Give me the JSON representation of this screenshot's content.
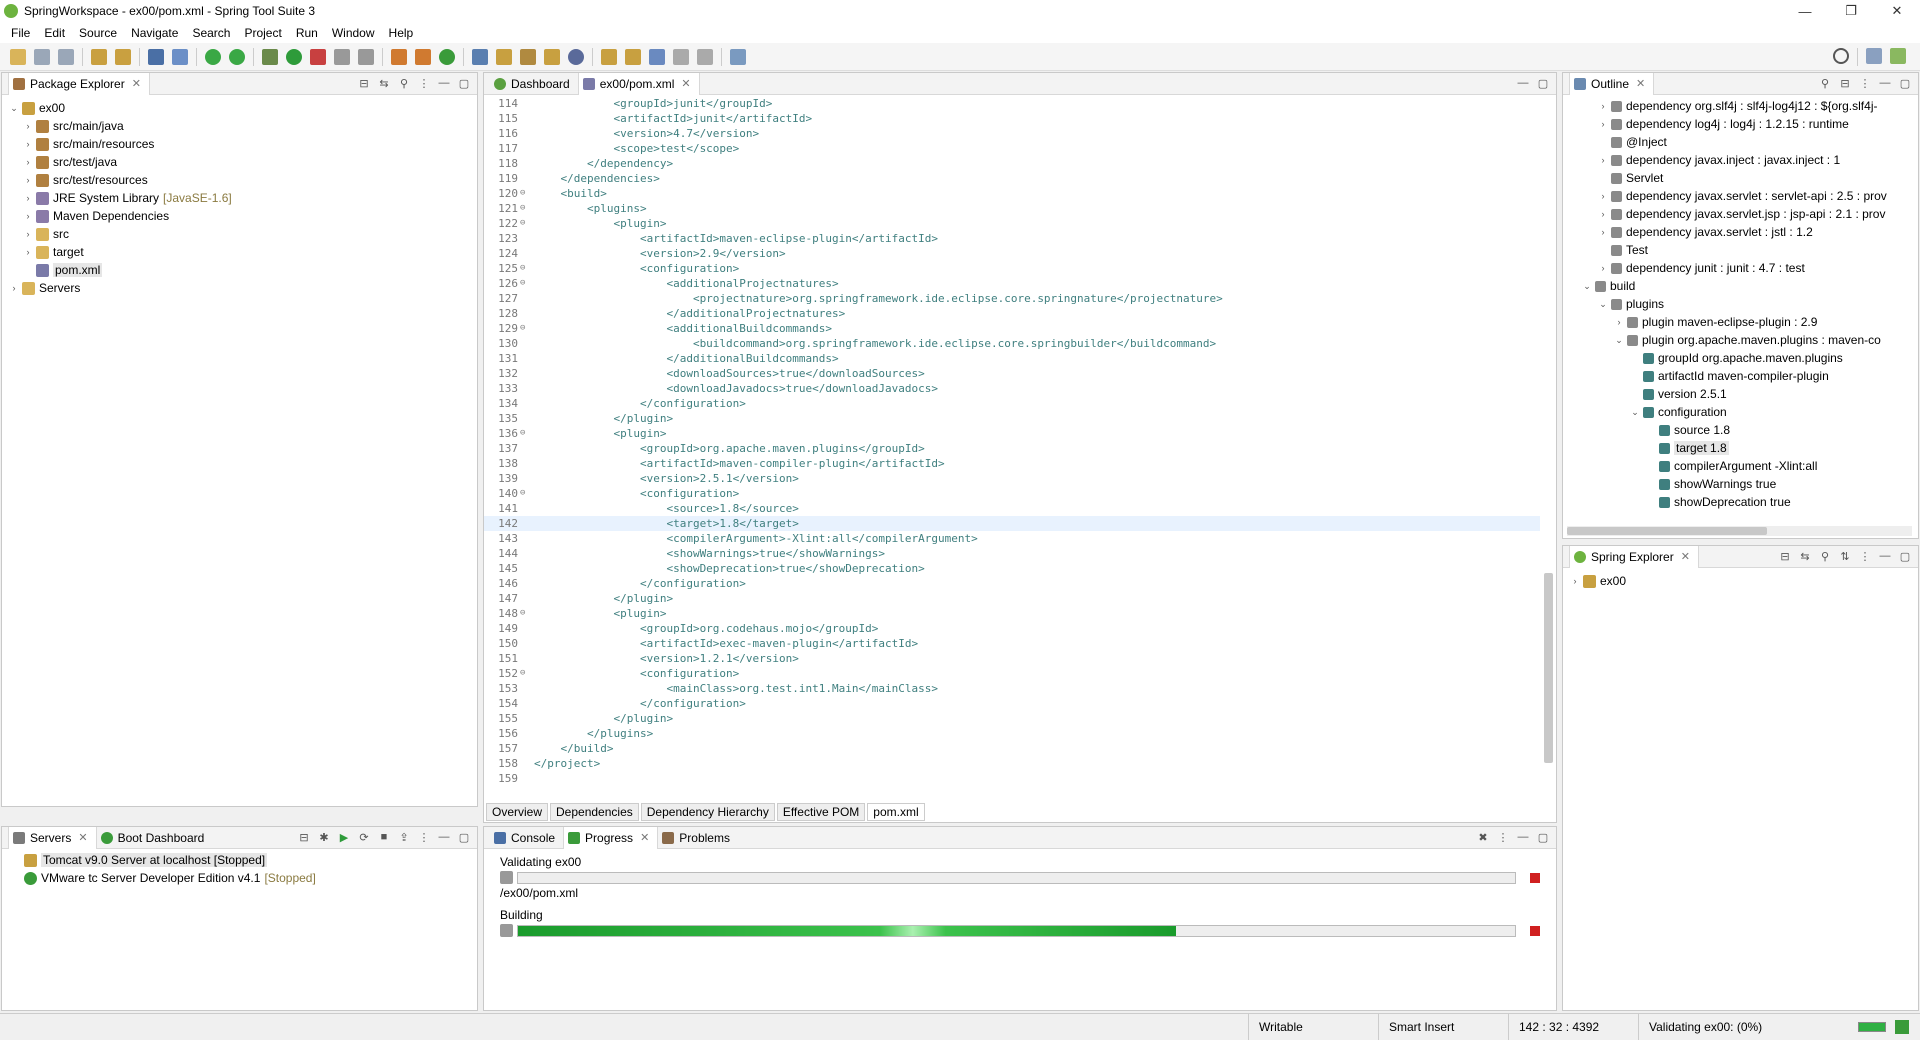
{
  "window": {
    "title": "SpringWorkspace - ex00/pom.xml - Spring Tool Suite 3",
    "controls": [
      "—",
      "❐",
      "✕"
    ]
  },
  "menu": [
    "File",
    "Edit",
    "Source",
    "Navigate",
    "Search",
    "Project",
    "Run",
    "Window",
    "Help"
  ],
  "package_explorer": {
    "tab_label": "Package Explorer",
    "items": [
      {
        "label": "ex00",
        "expanded": true,
        "depth": 0,
        "icon": "project-icon"
      },
      {
        "label": "src/main/java",
        "depth": 1,
        "icon": "source-folder-icon"
      },
      {
        "label": "src/main/resources",
        "depth": 1,
        "icon": "source-folder-icon"
      },
      {
        "label": "src/test/java",
        "depth": 1,
        "icon": "source-folder-icon"
      },
      {
        "label": "src/test/resources",
        "depth": 1,
        "icon": "source-folder-icon"
      },
      {
        "label": "JRE System Library",
        "extra": "[JavaSE-1.6]",
        "depth": 1,
        "icon": "library-icon"
      },
      {
        "label": "Maven Dependencies",
        "depth": 1,
        "icon": "library-icon"
      },
      {
        "label": "src",
        "depth": 1,
        "icon": "folder-icon"
      },
      {
        "label": "target",
        "depth": 1,
        "icon": "folder-icon"
      },
      {
        "label": "pom.xml",
        "depth": 1,
        "icon": "xml-file-icon",
        "selected": true
      },
      {
        "label": "Servers",
        "depth": 0,
        "icon": "folder-icon"
      }
    ]
  },
  "editor": {
    "tabs": [
      {
        "label": "Dashboard",
        "active": false
      },
      {
        "label": "ex00/pom.xml",
        "active": true
      }
    ],
    "lines": [
      {
        "n": "114",
        "text": "            <groupId>junit</groupId>"
      },
      {
        "n": "115",
        "text": "            <artifactId>junit</artifactId>"
      },
      {
        "n": "116",
        "text": "            <version>4.7</version>"
      },
      {
        "n": "117",
        "text": "            <scope>test</scope>"
      },
      {
        "n": "118",
        "text": "        </dependency>"
      },
      {
        "n": "119",
        "text": "    </dependencies>"
      },
      {
        "n": "120",
        "text": "    <build>",
        "fold": true
      },
      {
        "n": "121",
        "text": "        <plugins>",
        "fold": true
      },
      {
        "n": "122",
        "text": "            <plugin>",
        "fold": true
      },
      {
        "n": "123",
        "text": "                <artifactId>maven-eclipse-plugin</artifactId>"
      },
      {
        "n": "124",
        "text": "                <version>2.9</version>"
      },
      {
        "n": "125",
        "text": "                <configuration>",
        "fold": true
      },
      {
        "n": "126",
        "text": "                    <additionalProjectnatures>",
        "fold": true
      },
      {
        "n": "127",
        "text": "                        <projectnature>org.springframework.ide.eclipse.core.springnature</projectnature>"
      },
      {
        "n": "128",
        "text": "                    </additionalProjectnatures>"
      },
      {
        "n": "129",
        "text": "                    <additionalBuildcommands>",
        "fold": true
      },
      {
        "n": "130",
        "text": "                        <buildcommand>org.springframework.ide.eclipse.core.springbuilder</buildcommand>"
      },
      {
        "n": "131",
        "text": "                    </additionalBuildcommands>"
      },
      {
        "n": "132",
        "text": "                    <downloadSources>true</downloadSources>"
      },
      {
        "n": "133",
        "text": "                    <downloadJavadocs>true</downloadJavadocs>"
      },
      {
        "n": "134",
        "text": "                </configuration>"
      },
      {
        "n": "135",
        "text": "            </plugin>"
      },
      {
        "n": "136",
        "text": "            <plugin>",
        "fold": true
      },
      {
        "n": "137",
        "text": "                <groupId>org.apache.maven.plugins</groupId>"
      },
      {
        "n": "138",
        "text": "                <artifactId>maven-compiler-plugin</artifactId>"
      },
      {
        "n": "139",
        "text": "                <version>2.5.1</version>"
      },
      {
        "n": "140",
        "text": "                <configuration>",
        "fold": true
      },
      {
        "n": "141",
        "text": "                    <source>1.8</source>"
      },
      {
        "n": "142",
        "text": "                    <target>1.8</target>",
        "current": true
      },
      {
        "n": "143",
        "text": "                    <compilerArgument>-Xlint:all</compilerArgument>"
      },
      {
        "n": "144",
        "text": "                    <showWarnings>true</showWarnings>"
      },
      {
        "n": "145",
        "text": "                    <showDeprecation>true</showDeprecation>"
      },
      {
        "n": "146",
        "text": "                </configuration>"
      },
      {
        "n": "147",
        "text": "            </plugin>"
      },
      {
        "n": "148",
        "text": "            <plugin>",
        "fold": true
      },
      {
        "n": "149",
        "text": "                <groupId>org.codehaus.mojo</groupId>"
      },
      {
        "n": "150",
        "text": "                <artifactId>exec-maven-plugin</artifactId>"
      },
      {
        "n": "151",
        "text": "                <version>1.2.1</version>"
      },
      {
        "n": "152",
        "text": "                <configuration>",
        "fold": true
      },
      {
        "n": "153",
        "text": "                    <mainClass>org.test.int1.Main</mainClass>"
      },
      {
        "n": "154",
        "text": "                </configuration>"
      },
      {
        "n": "155",
        "text": "            </plugin>"
      },
      {
        "n": "156",
        "text": "        </plugins>"
      },
      {
        "n": "157",
        "text": "    </build>"
      },
      {
        "n": "158",
        "text": "</project>"
      },
      {
        "n": "159",
        "text": ""
      }
    ],
    "bottom_tabs": [
      "Overview",
      "Dependencies",
      "Dependency Hierarchy",
      "Effective POM",
      "pom.xml"
    ],
    "active_bottom_tab": "pom.xml"
  },
  "outline": {
    "tab_label": "Outline",
    "items": [
      {
        "label": "dependency  org.slf4j : slf4j-log4j12 : ${org.slf4j-",
        "depth": 1,
        "arrow": "›"
      },
      {
        "label": "dependency  log4j : log4j : 1.2.15 : runtime",
        "depth": 1,
        "arrow": "›"
      },
      {
        "label": "@Inject",
        "depth": 1,
        "arrow": ""
      },
      {
        "label": "dependency  javax.inject : javax.inject : 1",
        "depth": 1,
        "arrow": "›"
      },
      {
        "label": "Servlet",
        "depth": 1,
        "arrow": ""
      },
      {
        "label": "dependency  javax.servlet : servlet-api : 2.5 : prov",
        "depth": 1,
        "arrow": "›"
      },
      {
        "label": "dependency  javax.servlet.jsp : jsp-api : 2.1 : prov",
        "depth": 1,
        "arrow": "›"
      },
      {
        "label": "dependency  javax.servlet : jstl : 1.2",
        "depth": 1,
        "arrow": "›"
      },
      {
        "label": "Test",
        "depth": 1,
        "arrow": ""
      },
      {
        "label": "dependency  junit : junit : 4.7 : test",
        "depth": 1,
        "arrow": "›"
      },
      {
        "label": "build",
        "depth": 0,
        "arrow": "⌄"
      },
      {
        "label": "plugins",
        "depth": 1,
        "arrow": "⌄"
      },
      {
        "label": "plugin  maven-eclipse-plugin : 2.9",
        "depth": 2,
        "arrow": "›"
      },
      {
        "label": "plugin  org.apache.maven.plugins : maven-co",
        "depth": 2,
        "arrow": "⌄"
      },
      {
        "label": "groupId  org.apache.maven.plugins",
        "depth": 3,
        "arrow": ""
      },
      {
        "label": "artifactId  maven-compiler-plugin",
        "depth": 3,
        "arrow": ""
      },
      {
        "label": "version  2.5.1",
        "depth": 3,
        "arrow": ""
      },
      {
        "label": "configuration",
        "depth": 3,
        "arrow": "⌄"
      },
      {
        "label": "source  1.8",
        "depth": 4,
        "arrow": ""
      },
      {
        "label": "target  1.8",
        "depth": 4,
        "arrow": "",
        "selected": true
      },
      {
        "label": "compilerArgument  -Xlint:all",
        "depth": 4,
        "arrow": ""
      },
      {
        "label": "showWarnings  true",
        "depth": 4,
        "arrow": ""
      },
      {
        "label": "showDeprecation  true",
        "depth": 4,
        "arrow": ""
      }
    ]
  },
  "spring_explorer": {
    "tab_label": "Spring Explorer",
    "items": [
      {
        "label": "ex00"
      }
    ]
  },
  "servers": {
    "tabs": [
      "Servers",
      "Boot Dashboard"
    ],
    "items": [
      {
        "label": "Tomcat v9.0 Server at localhost  [Stopped]",
        "status": "",
        "selected": true
      },
      {
        "label": "VMware tc Server Developer Edition v4.1",
        "status": "[Stopped]"
      }
    ]
  },
  "console": {
    "tabs": [
      "Console",
      "Progress",
      "Problems"
    ],
    "progress": [
      {
        "title": "Validating ex00",
        "detail": "/ex00/pom.xml",
        "percent": 0
      },
      {
        "title": "Building",
        "detail": "",
        "percent": 66
      }
    ]
  },
  "status": {
    "writable": "Writable",
    "insert_mode": "Smart Insert",
    "position": "142 : 32 : 4392",
    "task": "Validating ex00: (0%)"
  }
}
